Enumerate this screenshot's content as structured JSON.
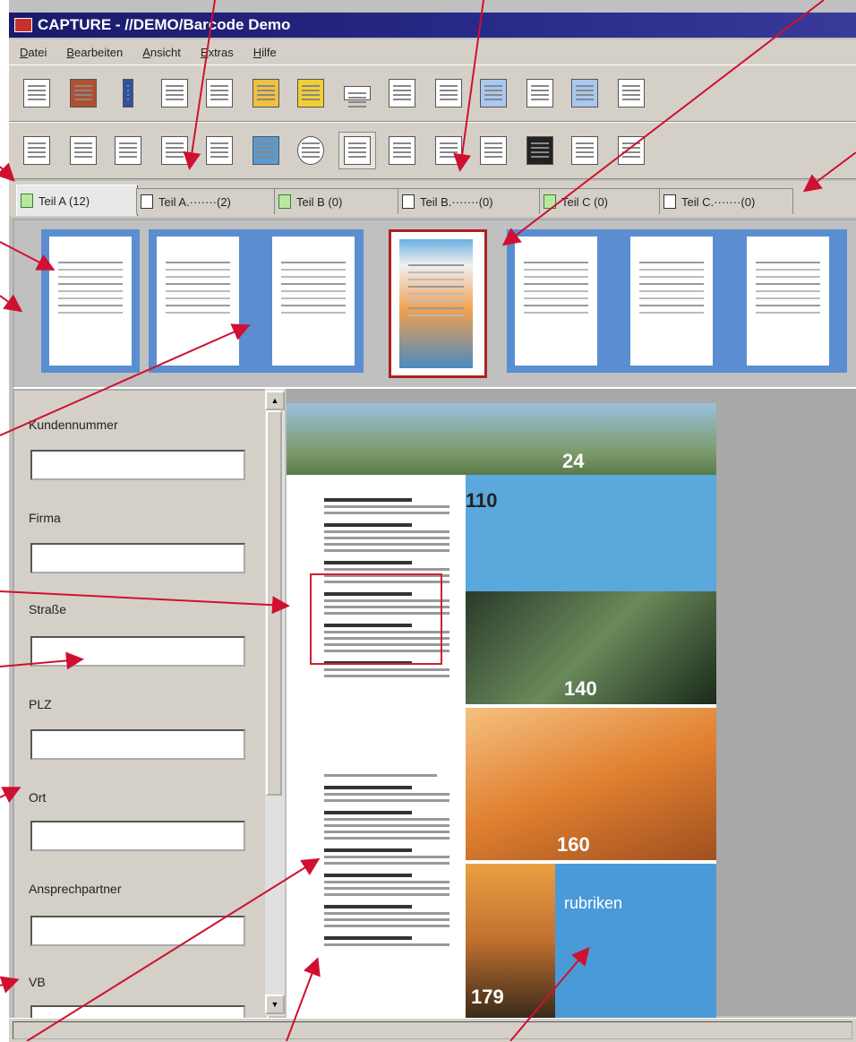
{
  "window": {
    "title": "CAPTURE - //DEMO/Barcode Demo"
  },
  "menu": [
    {
      "label": "Datei"
    },
    {
      "label": "Bearbeiten"
    },
    {
      "label": "Ansicht"
    },
    {
      "label": "Extras"
    },
    {
      "label": "Hilfe"
    }
  ],
  "tabs": [
    {
      "label": "Teil A (12)",
      "active": true
    },
    {
      "label": "Teil A.·······(2)"
    },
    {
      "label": "Teil B (0)"
    },
    {
      "label": "Teil B.·······(0)"
    },
    {
      "label": "Teil C (0)"
    },
    {
      "label": "Teil C.·······(0)"
    }
  ],
  "form": {
    "fields": [
      {
        "label": "Kundennummer",
        "value": ""
      },
      {
        "label": "Firma",
        "value": ""
      },
      {
        "label": "Straße",
        "value": ""
      },
      {
        "label": "PLZ",
        "value": ""
      },
      {
        "label": "Ort",
        "value": ""
      },
      {
        "label": "Ansprechpartner",
        "value": ""
      },
      {
        "label": "VB",
        "value": ""
      }
    ]
  },
  "document": {
    "numbers": [
      "24",
      "110",
      "140",
      "160",
      "179"
    ],
    "rubriken_heading": "rubriken"
  },
  "colors": {
    "annotation_arrow": "#d01030",
    "selection": "#b02020",
    "title_bar": "#1a1a6a"
  }
}
